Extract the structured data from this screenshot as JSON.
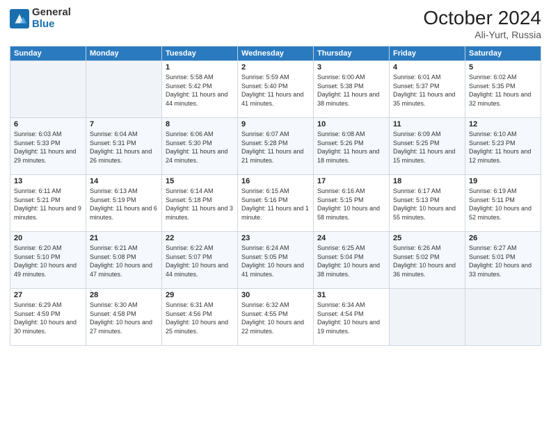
{
  "logo": {
    "general": "General",
    "blue": "Blue"
  },
  "header": {
    "month": "October 2024",
    "location": "Ali-Yurt, Russia"
  },
  "weekdays": [
    "Sunday",
    "Monday",
    "Tuesday",
    "Wednesday",
    "Thursday",
    "Friday",
    "Saturday"
  ],
  "weeks": [
    [
      {
        "day": "",
        "sunrise": "",
        "sunset": "",
        "daylight": ""
      },
      {
        "day": "",
        "sunrise": "",
        "sunset": "",
        "daylight": ""
      },
      {
        "day": "1",
        "sunrise": "Sunrise: 5:58 AM",
        "sunset": "Sunset: 5:42 PM",
        "daylight": "Daylight: 11 hours and 44 minutes."
      },
      {
        "day": "2",
        "sunrise": "Sunrise: 5:59 AM",
        "sunset": "Sunset: 5:40 PM",
        "daylight": "Daylight: 11 hours and 41 minutes."
      },
      {
        "day": "3",
        "sunrise": "Sunrise: 6:00 AM",
        "sunset": "Sunset: 5:38 PM",
        "daylight": "Daylight: 11 hours and 38 minutes."
      },
      {
        "day": "4",
        "sunrise": "Sunrise: 6:01 AM",
        "sunset": "Sunset: 5:37 PM",
        "daylight": "Daylight: 11 hours and 35 minutes."
      },
      {
        "day": "5",
        "sunrise": "Sunrise: 6:02 AM",
        "sunset": "Sunset: 5:35 PM",
        "daylight": "Daylight: 11 hours and 32 minutes."
      }
    ],
    [
      {
        "day": "6",
        "sunrise": "Sunrise: 6:03 AM",
        "sunset": "Sunset: 5:33 PM",
        "daylight": "Daylight: 11 hours and 29 minutes."
      },
      {
        "day": "7",
        "sunrise": "Sunrise: 6:04 AM",
        "sunset": "Sunset: 5:31 PM",
        "daylight": "Daylight: 11 hours and 26 minutes."
      },
      {
        "day": "8",
        "sunrise": "Sunrise: 6:06 AM",
        "sunset": "Sunset: 5:30 PM",
        "daylight": "Daylight: 11 hours and 24 minutes."
      },
      {
        "day": "9",
        "sunrise": "Sunrise: 6:07 AM",
        "sunset": "Sunset: 5:28 PM",
        "daylight": "Daylight: 11 hours and 21 minutes."
      },
      {
        "day": "10",
        "sunrise": "Sunrise: 6:08 AM",
        "sunset": "Sunset: 5:26 PM",
        "daylight": "Daylight: 11 hours and 18 minutes."
      },
      {
        "day": "11",
        "sunrise": "Sunrise: 6:09 AM",
        "sunset": "Sunset: 5:25 PM",
        "daylight": "Daylight: 11 hours and 15 minutes."
      },
      {
        "day": "12",
        "sunrise": "Sunrise: 6:10 AM",
        "sunset": "Sunset: 5:23 PM",
        "daylight": "Daylight: 11 hours and 12 minutes."
      }
    ],
    [
      {
        "day": "13",
        "sunrise": "Sunrise: 6:11 AM",
        "sunset": "Sunset: 5:21 PM",
        "daylight": "Daylight: 11 hours and 9 minutes."
      },
      {
        "day": "14",
        "sunrise": "Sunrise: 6:13 AM",
        "sunset": "Sunset: 5:19 PM",
        "daylight": "Daylight: 11 hours and 6 minutes."
      },
      {
        "day": "15",
        "sunrise": "Sunrise: 6:14 AM",
        "sunset": "Sunset: 5:18 PM",
        "daylight": "Daylight: 11 hours and 3 minutes."
      },
      {
        "day": "16",
        "sunrise": "Sunrise: 6:15 AM",
        "sunset": "Sunset: 5:16 PM",
        "daylight": "Daylight: 11 hours and 1 minute."
      },
      {
        "day": "17",
        "sunrise": "Sunrise: 6:16 AM",
        "sunset": "Sunset: 5:15 PM",
        "daylight": "Daylight: 10 hours and 58 minutes."
      },
      {
        "day": "18",
        "sunrise": "Sunrise: 6:17 AM",
        "sunset": "Sunset: 5:13 PM",
        "daylight": "Daylight: 10 hours and 55 minutes."
      },
      {
        "day": "19",
        "sunrise": "Sunrise: 6:19 AM",
        "sunset": "Sunset: 5:11 PM",
        "daylight": "Daylight: 10 hours and 52 minutes."
      }
    ],
    [
      {
        "day": "20",
        "sunrise": "Sunrise: 6:20 AM",
        "sunset": "Sunset: 5:10 PM",
        "daylight": "Daylight: 10 hours and 49 minutes."
      },
      {
        "day": "21",
        "sunrise": "Sunrise: 6:21 AM",
        "sunset": "Sunset: 5:08 PM",
        "daylight": "Daylight: 10 hours and 47 minutes."
      },
      {
        "day": "22",
        "sunrise": "Sunrise: 6:22 AM",
        "sunset": "Sunset: 5:07 PM",
        "daylight": "Daylight: 10 hours and 44 minutes."
      },
      {
        "day": "23",
        "sunrise": "Sunrise: 6:24 AM",
        "sunset": "Sunset: 5:05 PM",
        "daylight": "Daylight: 10 hours and 41 minutes."
      },
      {
        "day": "24",
        "sunrise": "Sunrise: 6:25 AM",
        "sunset": "Sunset: 5:04 PM",
        "daylight": "Daylight: 10 hours and 38 minutes."
      },
      {
        "day": "25",
        "sunrise": "Sunrise: 6:26 AM",
        "sunset": "Sunset: 5:02 PM",
        "daylight": "Daylight: 10 hours and 36 minutes."
      },
      {
        "day": "26",
        "sunrise": "Sunrise: 6:27 AM",
        "sunset": "Sunset: 5:01 PM",
        "daylight": "Daylight: 10 hours and 33 minutes."
      }
    ],
    [
      {
        "day": "27",
        "sunrise": "Sunrise: 6:29 AM",
        "sunset": "Sunset: 4:59 PM",
        "daylight": "Daylight: 10 hours and 30 minutes."
      },
      {
        "day": "28",
        "sunrise": "Sunrise: 6:30 AM",
        "sunset": "Sunset: 4:58 PM",
        "daylight": "Daylight: 10 hours and 27 minutes."
      },
      {
        "day": "29",
        "sunrise": "Sunrise: 6:31 AM",
        "sunset": "Sunset: 4:56 PM",
        "daylight": "Daylight: 10 hours and 25 minutes."
      },
      {
        "day": "30",
        "sunrise": "Sunrise: 6:32 AM",
        "sunset": "Sunset: 4:55 PM",
        "daylight": "Daylight: 10 hours and 22 minutes."
      },
      {
        "day": "31",
        "sunrise": "Sunrise: 6:34 AM",
        "sunset": "Sunset: 4:54 PM",
        "daylight": "Daylight: 10 hours and 19 minutes."
      },
      {
        "day": "",
        "sunrise": "",
        "sunset": "",
        "daylight": ""
      },
      {
        "day": "",
        "sunrise": "",
        "sunset": "",
        "daylight": ""
      }
    ]
  ]
}
